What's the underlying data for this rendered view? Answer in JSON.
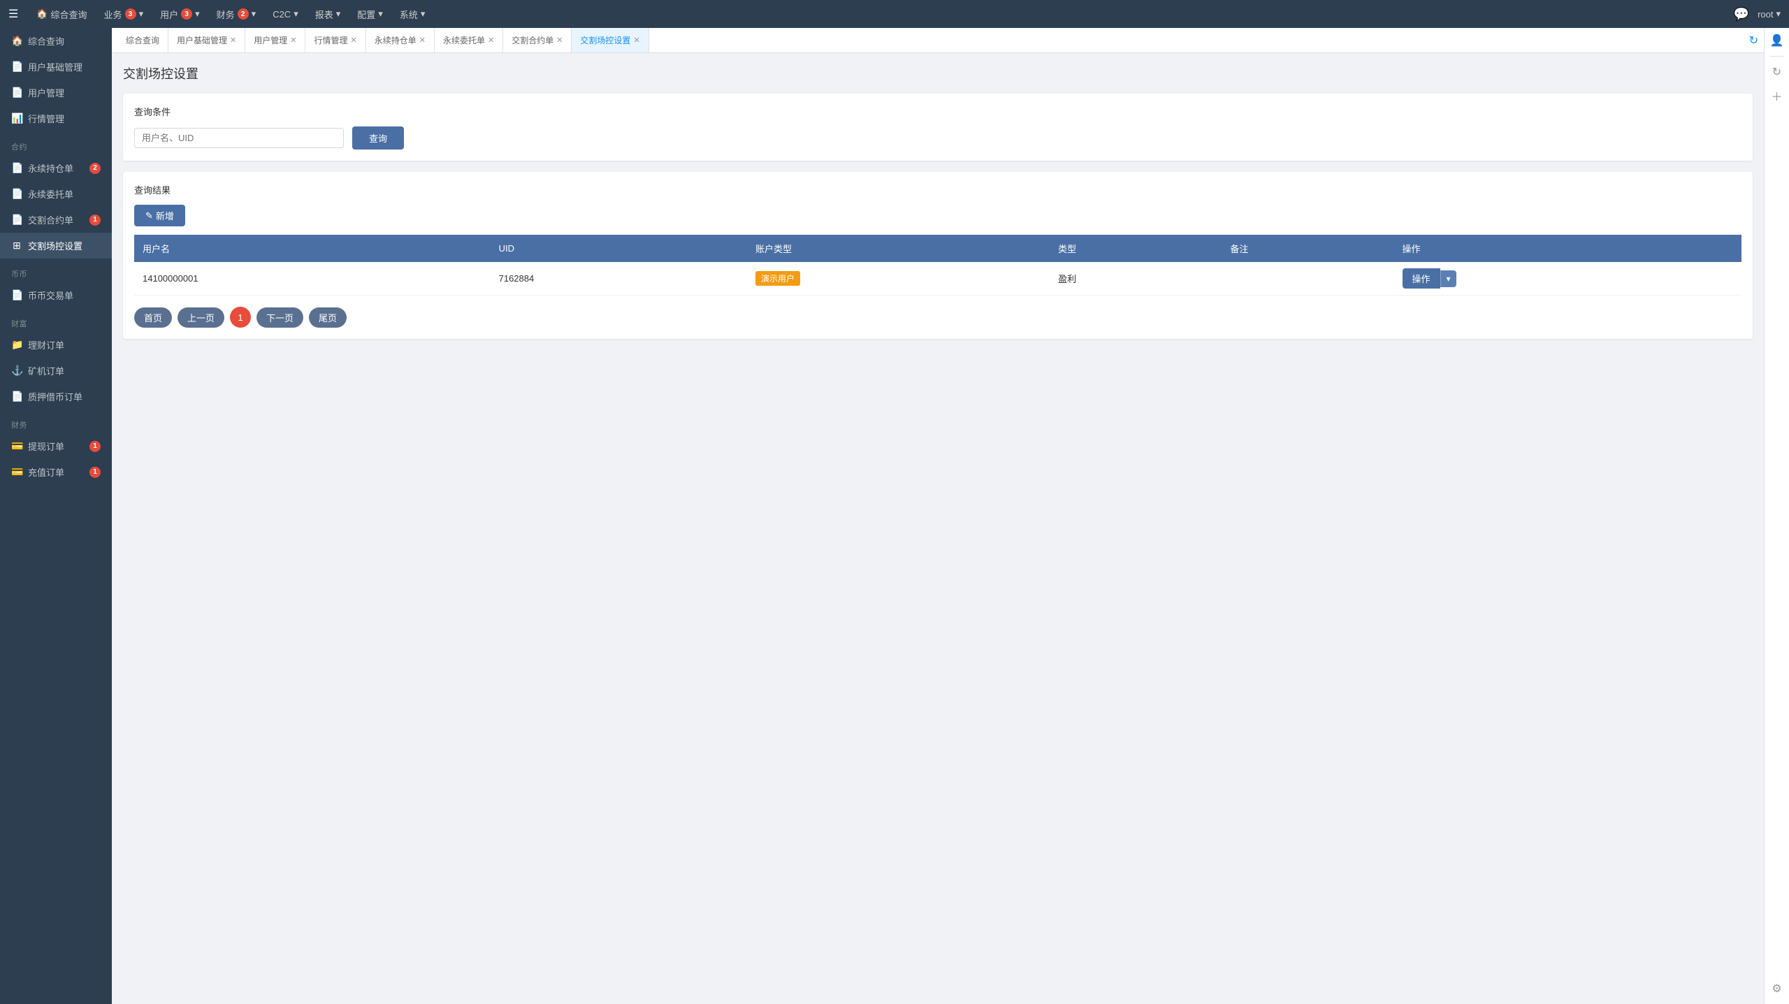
{
  "topNav": {
    "hamburger": "☰",
    "items": [
      {
        "id": "home",
        "label": "综合查询",
        "icon": "🏠",
        "badge": null,
        "hasHome": true
      },
      {
        "id": "business",
        "label": "业务",
        "badge": "3",
        "hasDropdown": true
      },
      {
        "id": "user",
        "label": "用户",
        "badge": "3",
        "hasDropdown": true
      },
      {
        "id": "finance",
        "label": "财务",
        "badge": "2",
        "hasDropdown": true
      },
      {
        "id": "c2c",
        "label": "C2C",
        "badge": null,
        "hasDropdown": true
      },
      {
        "id": "report",
        "label": "报表",
        "badge": null,
        "hasDropdown": true
      },
      {
        "id": "config",
        "label": "配置",
        "badge": null,
        "hasDropdown": true
      },
      {
        "id": "system",
        "label": "系统",
        "badge": null,
        "hasDropdown": true
      }
    ],
    "userLabel": "root",
    "chatIcon": "💬"
  },
  "tabs": [
    {
      "id": "overview",
      "label": "综合查询",
      "closable": false,
      "active": false
    },
    {
      "id": "userbase",
      "label": "用户基础管理",
      "closable": true,
      "active": false
    },
    {
      "id": "usermgr",
      "label": "用户管理",
      "closable": true,
      "active": false
    },
    {
      "id": "market",
      "label": "行情管理",
      "closable": true,
      "active": false
    },
    {
      "id": "perpetual",
      "label": "永续持仓单",
      "closable": true,
      "active": false
    },
    {
      "id": "delegate",
      "label": "永续委托单",
      "closable": true,
      "active": false
    },
    {
      "id": "contract",
      "label": "交割合约单",
      "closable": true,
      "active": false
    },
    {
      "id": "venue",
      "label": "交割场控设置",
      "closable": true,
      "active": true
    }
  ],
  "sidebar": {
    "topItems": [
      {
        "id": "overview",
        "label": "综合查询",
        "icon": "🏠",
        "badge": null
      }
    ],
    "sections": [
      {
        "label": "",
        "items": [
          {
            "id": "userbase",
            "label": "用户基础管理",
            "icon": "📄",
            "badge": null
          },
          {
            "id": "usermgr",
            "label": "用户管理",
            "icon": "📄",
            "badge": null
          },
          {
            "id": "market",
            "label": "行情管理",
            "icon": "📊",
            "badge": null
          }
        ]
      },
      {
        "label": "合约",
        "items": [
          {
            "id": "perpetual-pos",
            "label": "永续持仓单",
            "icon": "📄",
            "badge": "2"
          },
          {
            "id": "perpetual-del",
            "label": "永续委托单",
            "icon": "📄",
            "badge": null
          },
          {
            "id": "contract-order",
            "label": "交割合约单",
            "icon": "📄",
            "badge": "1"
          },
          {
            "id": "venue-ctrl",
            "label": "交割场控设置",
            "icon": "⊞",
            "badge": null,
            "active": true
          }
        ]
      },
      {
        "label": "币币",
        "items": [
          {
            "id": "coin-trade",
            "label": "币币交易单",
            "icon": "📄",
            "badge": null
          }
        ]
      },
      {
        "label": "财富",
        "items": [
          {
            "id": "wealth-order",
            "label": "理财订单",
            "icon": "📁",
            "badge": null
          },
          {
            "id": "miner-order",
            "label": "矿机订单",
            "icon": "⚓",
            "badge": null
          },
          {
            "id": "pledge-order",
            "label": "质押借币订单",
            "icon": "📄",
            "badge": null
          }
        ]
      },
      {
        "label": "财务",
        "items": [
          {
            "id": "withdraw",
            "label": "提现订单",
            "icon": "💳",
            "badge": "1"
          },
          {
            "id": "recharge",
            "label": "充值订单",
            "icon": "💳",
            "badge": "1"
          }
        ]
      }
    ]
  },
  "page": {
    "title": "交割场控设置",
    "searchSection": {
      "label": "查询条件",
      "placeholder": "用户名、UID",
      "searchBtnLabel": "查询"
    },
    "resultsSection": {
      "label": "查询结果",
      "addBtnLabel": "新增",
      "table": {
        "columns": [
          "用户名",
          "UID",
          "账户类型",
          "类型",
          "备注",
          "操作"
        ],
        "rows": [
          {
            "username": "14100000001",
            "uid": "7162884",
            "accountType": "演示用户",
            "accountTypeBadge": true,
            "type": "盈利",
            "remark": "",
            "action": "操作"
          }
        ]
      },
      "pagination": {
        "items": [
          {
            "id": "first",
            "label": "首页"
          },
          {
            "id": "prev",
            "label": "上一页"
          },
          {
            "id": "page1",
            "label": "1",
            "current": true
          },
          {
            "id": "next",
            "label": "下一页"
          },
          {
            "id": "last",
            "label": "尾页"
          }
        ]
      }
    }
  },
  "rightPanel": {
    "icons": [
      "↻",
      "+"
    ]
  }
}
